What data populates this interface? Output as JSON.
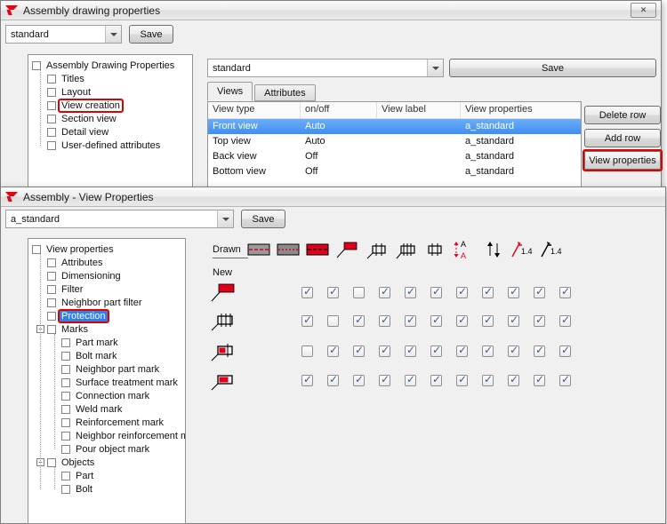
{
  "colors": {
    "callout_red": "#e00000",
    "selection_blue": "#3e8ef3",
    "tekla_red": "#e30613"
  },
  "top": {
    "title": "Assembly drawing properties",
    "close_glyph": "✕",
    "preset": {
      "value": "standard"
    },
    "save_label": "Save",
    "tree": {
      "root": "Assembly Drawing Properties",
      "items": [
        "Titles",
        "Layout",
        "View creation",
        "Section view",
        "Detail view",
        "User-defined attributes"
      ]
    },
    "right": {
      "preset": {
        "value": "standard"
      },
      "save_label": "Save",
      "tabs": [
        "Views",
        "Attributes"
      ],
      "table": {
        "columns": [
          "View type",
          "on/off",
          "View label",
          "View properties"
        ],
        "rows": [
          [
            "Front view",
            "Auto",
            "",
            "a_standard"
          ],
          [
            "Top view",
            "Auto",
            "",
            "a_standard"
          ],
          [
            "Back view",
            "Off",
            "",
            "a_standard"
          ],
          [
            "Bottom view",
            "Off",
            "",
            "a_standard"
          ]
        ],
        "selected_row": 0
      },
      "buttons": {
        "delete_row": "Delete row",
        "add_row": "Add row",
        "view_properties": "View properties"
      }
    }
  },
  "bottom": {
    "title": "Assembly - View Properties",
    "preset": {
      "value": "a_standard"
    },
    "save_label": "Save",
    "tree": {
      "root": "View properties",
      "items": [
        "Attributes",
        "Dimensioning",
        "Filter",
        "Neighbor part filter",
        "Protection"
      ],
      "marks_label": "Marks",
      "marks_items": [
        "Part mark",
        "Bolt mark",
        "Neighbor part mark",
        "Surface treatment mark",
        "Connection mark",
        "Weld mark",
        "Reinforcement mark",
        "Neighbor reinforcement ma",
        "Pour object mark"
      ],
      "objects_label": "Objects",
      "objects_items": [
        "Part",
        "Bolt"
      ]
    },
    "grid": {
      "drawn_label": "Drawn",
      "new_label": "New",
      "column_icons": [
        "drawn-mark-gray-icon",
        "drawn-mark-gray-dashed-icon",
        "drawn-mark-red-icon",
        "leader-mark-icon",
        "frame-mark-icon",
        "frame-mark-ticks-icon",
        "frame-mark-small-icon",
        "swap-text-red-icon",
        "swap-arrows-icon",
        "level-mark-red-icon",
        "level-mark-black-icon"
      ],
      "rows": [
        {
          "icon": "part-mark-icon",
          "checks": [
            true,
            true,
            false,
            true,
            true,
            true,
            true,
            true,
            true,
            true,
            true
          ]
        },
        {
          "icon": "assembly-mark-icon",
          "checks": [
            true,
            false,
            true,
            true,
            true,
            true,
            true,
            true,
            true,
            true,
            true
          ]
        },
        {
          "icon": "cast-unit-mark-icon",
          "checks": [
            false,
            true,
            true,
            true,
            true,
            true,
            true,
            true,
            true,
            true,
            true
          ]
        },
        {
          "icon": "reinforcement-mark-icon",
          "checks": [
            true,
            true,
            true,
            true,
            true,
            true,
            true,
            true,
            true,
            true,
            true
          ]
        }
      ]
    }
  }
}
